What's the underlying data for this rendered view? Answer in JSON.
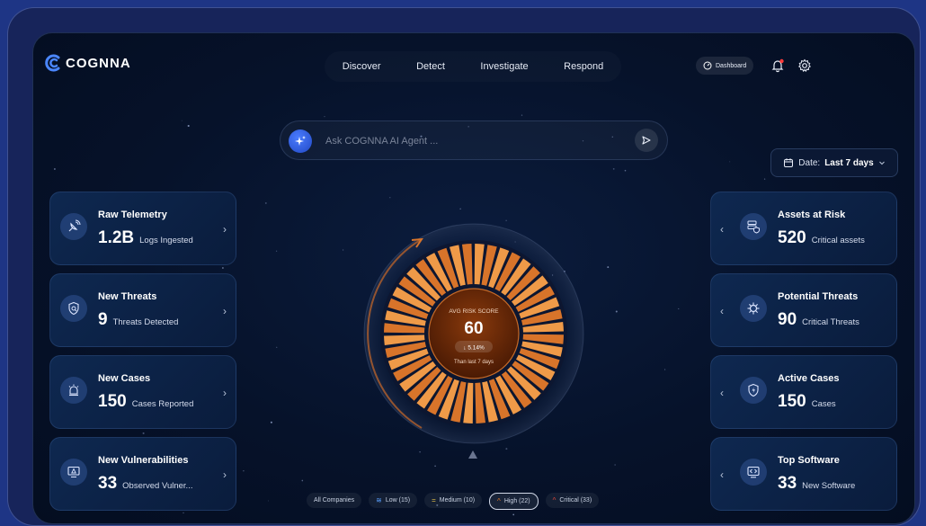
{
  "app": {
    "logo_text": "COGNNA"
  },
  "nav": {
    "items": [
      "Discover",
      "Detect",
      "Investigate",
      "Respond"
    ]
  },
  "header": {
    "dashboard_label": "Dashboard"
  },
  "ask": {
    "placeholder": "Ask COGNNA AI Agent ..."
  },
  "date_filter": {
    "label": "Date:",
    "value": "Last 7 days"
  },
  "left_cards": [
    {
      "title": "Raw Telemetry",
      "value": "1.2B",
      "subtitle": "Logs Ingested",
      "icon": "satellite-icon"
    },
    {
      "title": "New Threats",
      "value": "9",
      "subtitle": "Threats Detected",
      "icon": "shield-search-icon"
    },
    {
      "title": "New Cases",
      "value": "150",
      "subtitle": "Cases Reported",
      "icon": "alarm-icon"
    },
    {
      "title": "New Vulnerabilities",
      "value": "33",
      "subtitle": "Observed Vulner...",
      "icon": "monitor-alert-icon"
    }
  ],
  "right_cards": [
    {
      "title": "Assets at Risk",
      "value": "520",
      "subtitle": "Critical assets",
      "icon": "server-shield-icon"
    },
    {
      "title": "Potential Threats",
      "value": "90",
      "subtitle": "Critical Threats",
      "icon": "virus-icon"
    },
    {
      "title": "Active Cases",
      "value": "150",
      "subtitle": "Cases",
      "icon": "shield-bolt-icon"
    },
    {
      "title": "Top Software",
      "value": "33",
      "subtitle": "New Software",
      "icon": "code-window-icon"
    }
  ],
  "risk": {
    "label": "AVG RISK SCORE",
    "score": "60",
    "change": "5.14%",
    "period": "Than last 7 days",
    "colors": {
      "segment": "#d8742a",
      "segment_light": "#ef9a48",
      "core": "#6a2a08"
    }
  },
  "filters": [
    {
      "label": "All Companies"
    },
    {
      "label": "Low (15)",
      "color": "#5aa0ff"
    },
    {
      "label": "Medium (10)",
      "color": "#e6c24a"
    },
    {
      "label": "High (22)",
      "color": "#e07a2a",
      "active": true
    },
    {
      "label": "Critical (33)",
      "color": "#e0483a"
    }
  ]
}
